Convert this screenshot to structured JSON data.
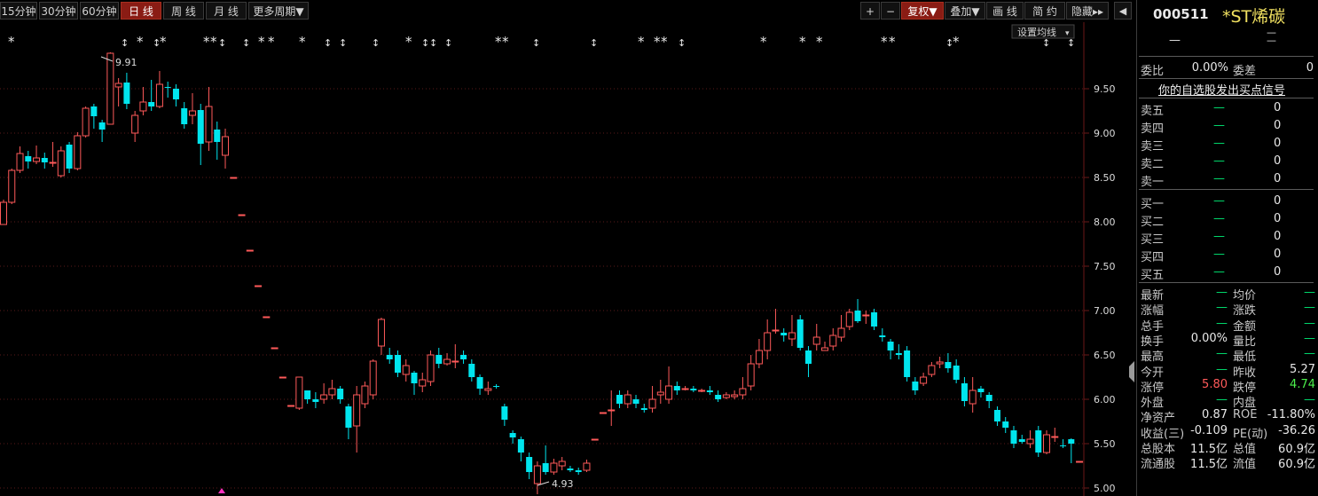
{
  "toolbar": {
    "periods": [
      "15分钟",
      "30分钟",
      "60分钟",
      "日 线",
      "周 线",
      "月 线",
      "更多周期▼"
    ],
    "active_period": "日 线",
    "right": [
      "+",
      "−",
      "复权▼",
      "叠加▼",
      "画 线",
      "简 约",
      "隐藏▸▸"
    ],
    "active_right": "复权▼"
  },
  "chart": {
    "ma_setting_label": "设置均线",
    "price_ticks": [
      "9.50",
      "9.00",
      "8.50",
      "8.00",
      "7.50",
      "7.00",
      "6.50",
      "6.00",
      "5.50",
      "5.00"
    ],
    "high_label": "9.91",
    "low_label": "4.93",
    "colors": {
      "up": "#ff5a5a",
      "down": "#00e5ee",
      "grid": "#5a1a1a",
      "axis": "#dcdcdc",
      "marker": "#e8e8e8"
    }
  },
  "chart_data": {
    "type": "candlestick",
    "y_range": [
      4.95,
      9.95
    ],
    "high": 9.91,
    "low": 4.93,
    "candles": [
      [
        7.97,
        8.22,
        8.25,
        7.97
      ],
      [
        8.22,
        8.58,
        8.6,
        8.2
      ],
      [
        8.58,
        8.77,
        8.85,
        8.55
      ],
      [
        8.74,
        8.68,
        8.8,
        8.6
      ],
      [
        8.68,
        8.72,
        8.86,
        8.65
      ],
      [
        8.72,
        8.67,
        8.78,
        8.6
      ],
      [
        8.67,
        8.67,
        8.9,
        8.62
      ],
      [
        8.52,
        8.8,
        8.85,
        8.5
      ],
      [
        8.87,
        8.6,
        8.9,
        8.55
      ],
      [
        8.6,
        8.97,
        9.01,
        8.58
      ],
      [
        8.97,
        9.28,
        9.3,
        8.95
      ],
      [
        9.3,
        9.19,
        9.33,
        9.05
      ],
      [
        9.12,
        9.04,
        9.15,
        8.9
      ],
      [
        9.1,
        9.9,
        9.91,
        9.1
      ],
      [
        9.52,
        9.56,
        9.62,
        9.3
      ],
      [
        9.57,
        9.33,
        9.68,
        9.27
      ],
      [
        9.0,
        9.2,
        9.25,
        8.9
      ],
      [
        9.25,
        9.35,
        9.52,
        9.2
      ],
      [
        9.35,
        9.3,
        9.6,
        9.25
      ],
      [
        9.3,
        9.55,
        9.7,
        9.28
      ],
      [
        9.52,
        9.51,
        9.58,
        9.4
      ],
      [
        9.5,
        9.38,
        9.55,
        9.3
      ],
      [
        9.28,
        9.1,
        9.35,
        9.05
      ],
      [
        9.2,
        9.25,
        9.45,
        9.1
      ],
      [
        9.26,
        8.88,
        9.33,
        8.64
      ],
      [
        8.9,
        9.3,
        9.52,
        8.8
      ],
      [
        9.04,
        8.9,
        9.13,
        8.7
      ],
      [
        8.75,
        8.96,
        9.05,
        8.6
      ],
      [
        8.5,
        8.5,
        8.5,
        8.5
      ],
      [
        8.08,
        8.08,
        8.08,
        8.08
      ],
      [
        7.68,
        7.68,
        7.68,
        7.68
      ],
      [
        7.28,
        7.28,
        7.28,
        7.28
      ],
      [
        6.93,
        6.93,
        6.93,
        6.93
      ],
      [
        6.58,
        6.58,
        6.58,
        6.58
      ],
      [
        6.25,
        6.25,
        6.25,
        6.25
      ],
      [
        5.93,
        5.93,
        5.93,
        5.93
      ],
      [
        5.9,
        6.25,
        6.25,
        5.88
      ],
      [
        6.1,
        6.0,
        6.1,
        5.95
      ],
      [
        6.0,
        5.97,
        6.08,
        5.9
      ],
      [
        6.0,
        6.05,
        6.18,
        5.95
      ],
      [
        6.05,
        6.12,
        6.22,
        6.0
      ],
      [
        6.12,
        6.0,
        6.15,
        5.95
      ],
      [
        5.92,
        5.68,
        5.95,
        5.55
      ],
      [
        5.7,
        6.05,
        6.15,
        5.4
      ],
      [
        5.95,
        6.15,
        6.2,
        5.9
      ],
      [
        6.05,
        6.43,
        6.45,
        6.0
      ],
      [
        6.6,
        6.9,
        6.92,
        6.5
      ],
      [
        6.5,
        6.45,
        6.58,
        6.4
      ],
      [
        6.5,
        6.3,
        6.55,
        6.25
      ],
      [
        6.28,
        6.38,
        6.45,
        6.2
      ],
      [
        6.3,
        6.18,
        6.32,
        6.05
      ],
      [
        6.15,
        6.22,
        6.3,
        6.08
      ],
      [
        6.2,
        6.5,
        6.55,
        6.15
      ],
      [
        6.5,
        6.4,
        6.58,
        6.35
      ],
      [
        6.4,
        6.45,
        6.52,
        6.38
      ],
      [
        6.42,
        6.43,
        6.62,
        6.35
      ],
      [
        6.5,
        6.45,
        6.55,
        6.4
      ],
      [
        6.4,
        6.25,
        6.45,
        6.2
      ],
      [
        6.25,
        6.12,
        6.28,
        6.05
      ],
      [
        6.1,
        6.12,
        6.2,
        6.05
      ],
      [
        6.15,
        6.14,
        6.17,
        6.12
      ],
      [
        5.92,
        5.77,
        5.95,
        5.7
      ],
      [
        5.62,
        5.57,
        5.65,
        5.5
      ],
      [
        5.55,
        5.4,
        5.58,
        5.3
      ],
      [
        5.35,
        5.18,
        5.4,
        5.1
      ],
      [
        5.05,
        5.25,
        5.3,
        4.93
      ],
      [
        5.28,
        5.18,
        5.48,
        5.15
      ],
      [
        5.18,
        5.28,
        5.33,
        5.15
      ],
      [
        5.25,
        5.3,
        5.35,
        5.2
      ],
      [
        5.22,
        5.2,
        5.25,
        5.18
      ],
      [
        5.2,
        5.18,
        5.23,
        5.15
      ],
      [
        5.2,
        5.28,
        5.32,
        5.18
      ],
      [
        5.55,
        5.55,
        5.55,
        5.55
      ],
      [
        5.85,
        5.85,
        5.85,
        5.85
      ],
      [
        5.88,
        5.88,
        6.1,
        5.7
      ],
      [
        6.05,
        5.95,
        6.1,
        5.9
      ],
      [
        5.95,
        6.05,
        6.1,
        5.9
      ],
      [
        6.0,
        5.95,
        6.05,
        5.9
      ],
      [
        5.9,
        5.88,
        5.95,
        5.85
      ],
      [
        5.9,
        6.0,
        6.15,
        5.85
      ],
      [
        6.05,
        6.08,
        6.22,
        5.95
      ],
      [
        6.0,
        6.15,
        6.37,
        5.95
      ],
      [
        6.15,
        6.1,
        6.2,
        6.05
      ],
      [
        6.12,
        6.12,
        6.15,
        6.1
      ],
      [
        6.12,
        6.1,
        6.15,
        6.08
      ],
      [
        6.1,
        6.1,
        6.12,
        6.08
      ],
      [
        6.1,
        6.08,
        6.15,
        6.05
      ],
      [
        6.05,
        6.0,
        6.1,
        5.97
      ],
      [
        6.02,
        6.05,
        6.08,
        6.0
      ],
      [
        6.03,
        6.05,
        6.1,
        6.0
      ],
      [
        6.05,
        6.12,
        6.25,
        6.0
      ],
      [
        6.15,
        6.4,
        6.5,
        6.1
      ],
      [
        6.4,
        6.55,
        6.68,
        6.35
      ],
      [
        6.55,
        6.75,
        6.9,
        6.45
      ],
      [
        6.78,
        6.78,
        7.02,
        6.74
      ],
      [
        6.75,
        6.72,
        6.8,
        6.65
      ],
      [
        6.68,
        6.75,
        6.95,
        6.6
      ],
      [
        6.9,
        6.58,
        6.95,
        6.55
      ],
      [
        6.55,
        6.4,
        6.6,
        6.25
      ],
      [
        6.62,
        6.7,
        6.85,
        6.55
      ],
      [
        6.55,
        6.58,
        6.65,
        6.55
      ],
      [
        6.6,
        6.72,
        6.8,
        6.55
      ],
      [
        6.7,
        6.8,
        6.95,
        6.65
      ],
      [
        6.82,
        6.98,
        7.02,
        6.78
      ],
      [
        7.0,
        6.88,
        7.13,
        6.86
      ],
      [
        6.95,
        6.95,
        7.0,
        6.85
      ],
      [
        6.98,
        6.82,
        7.02,
        6.78
      ],
      [
        6.72,
        6.7,
        6.8,
        6.65
      ],
      [
        6.65,
        6.55,
        6.68,
        6.45
      ],
      [
        6.52,
        6.5,
        6.62,
        6.45
      ],
      [
        6.55,
        6.25,
        6.6,
        6.2
      ],
      [
        6.2,
        6.1,
        6.25,
        6.05
      ],
      [
        6.18,
        6.25,
        6.3,
        6.15
      ],
      [
        6.28,
        6.38,
        6.42,
        6.25
      ],
      [
        6.4,
        6.42,
        6.48,
        6.35
      ],
      [
        6.42,
        6.35,
        6.52,
        6.3
      ],
      [
        6.38,
        6.22,
        6.45,
        6.18
      ],
      [
        6.18,
        5.98,
        6.25,
        5.92
      ],
      [
        5.95,
        6.1,
        6.25,
        5.85
      ],
      [
        6.12,
        6.08,
        6.15,
        6.02
      ],
      [
        6.05,
        5.98,
        6.08,
        5.9
      ],
      [
        5.88,
        5.75,
        5.92,
        5.7
      ],
      [
        5.75,
        5.68,
        5.8,
        5.62
      ],
      [
        5.65,
        5.5,
        5.7,
        5.45
      ],
      [
        5.55,
        5.52,
        5.6,
        5.5
      ],
      [
        5.5,
        5.55,
        5.65,
        5.45
      ],
      [
        5.65,
        5.4,
        5.7,
        5.35
      ],
      [
        5.4,
        5.6,
        5.65,
        5.38
      ],
      [
        5.58,
        5.58,
        5.68,
        5.52
      ],
      [
        5.48,
        5.47,
        5.55,
        5.45
      ],
      [
        5.55,
        5.5,
        5.56,
        5.28
      ],
      [
        5.3,
        5.3,
        5.3,
        5.3
      ]
    ],
    "markers": [
      [
        "*",
        13
      ],
      [
        "↕",
        140
      ],
      [
        "*",
        158
      ],
      [
        "↕",
        176
      ],
      [
        "*",
        184
      ],
      [
        "*",
        233
      ],
      [
        "*",
        241
      ],
      [
        "↕",
        250
      ],
      [
        "↕",
        277
      ],
      [
        "*",
        295
      ],
      [
        "*",
        306
      ],
      [
        "*",
        341
      ],
      [
        "↕",
        369
      ],
      [
        "↕",
        386
      ],
      [
        "↕",
        423
      ],
      [
        "*",
        461
      ],
      [
        "↕",
        479
      ],
      [
        "↕",
        488
      ],
      [
        "↕",
        505
      ],
      [
        "*",
        562
      ],
      [
        "*",
        570
      ],
      [
        "↕",
        604
      ],
      [
        "↕",
        669
      ],
      [
        "*",
        723
      ],
      [
        "*",
        741
      ],
      [
        "*",
        749
      ],
      [
        "↕",
        768
      ],
      [
        "*",
        861
      ],
      [
        "*",
        905
      ],
      [
        "*",
        924
      ],
      [
        "*",
        997
      ],
      [
        "*",
        1006
      ],
      [
        "↕",
        1070
      ],
      [
        "*",
        1078
      ],
      [
        "↕",
        1179
      ],
      [
        "↕",
        1207
      ]
    ]
  },
  "panel": {
    "stock_code": "000511",
    "stock_name": "*ST烯碳",
    "price_dash": "—",
    "change_dash": "—",
    "weibi": {
      "label": "委比",
      "value": "0.00%",
      "diff_label": "委差",
      "diff_value": "0"
    },
    "signal_link": "你的自选股发出买点信号",
    "sell": [
      {
        "label": "卖五",
        "price": "—",
        "vol": "0"
      },
      {
        "label": "卖四",
        "price": "—",
        "vol": "0"
      },
      {
        "label": "卖三",
        "price": "—",
        "vol": "0"
      },
      {
        "label": "卖二",
        "price": "—",
        "vol": "0"
      },
      {
        "label": "卖一",
        "price": "—",
        "vol": "0"
      }
    ],
    "buy": [
      {
        "label": "买一",
        "price": "—",
        "vol": "0"
      },
      {
        "label": "买二",
        "price": "—",
        "vol": "0"
      },
      {
        "label": "买三",
        "price": "—",
        "vol": "0"
      },
      {
        "label": "买四",
        "price": "—",
        "vol": "0"
      },
      {
        "label": "买五",
        "price": "—",
        "vol": "0"
      }
    ],
    "stats": [
      {
        "l1": "最新",
        "v1": "—",
        "l2": "均价",
        "v2": "—"
      },
      {
        "l1": "涨幅",
        "v1": "—",
        "l2": "涨跌",
        "v2": "—"
      },
      {
        "l1": "总手",
        "v1": "—",
        "l2": "金额",
        "v2": "—"
      },
      {
        "l1": "换手",
        "v1": "0.00%",
        "l2": "量比",
        "v2": "—"
      },
      {
        "l1": "最高",
        "v1": "—",
        "l2": "最低",
        "v2": "—"
      },
      {
        "l1": "今开",
        "v1": "—",
        "l2": "昨收",
        "v2": "5.27"
      },
      {
        "l1": "涨停",
        "v1": "5.80",
        "l2": "跌停",
        "v2": "4.74"
      },
      {
        "l1": "外盘",
        "v1": "—",
        "l2": "内盘",
        "v2": "—"
      },
      {
        "l1": "净资产",
        "v1": "0.87",
        "l2": "ROE",
        "v2": "-11.80%"
      },
      {
        "l1": "收益(三)",
        "v1": "-0.109",
        "l2": "PE(动)",
        "v2": "-36.26"
      },
      {
        "l1": "总股本",
        "v1": "11.5亿",
        "l2": "总值",
        "v2": "60.9亿"
      },
      {
        "l1": "流通股",
        "v1": "11.5亿",
        "l2": "流值",
        "v2": "60.9亿"
      }
    ]
  }
}
